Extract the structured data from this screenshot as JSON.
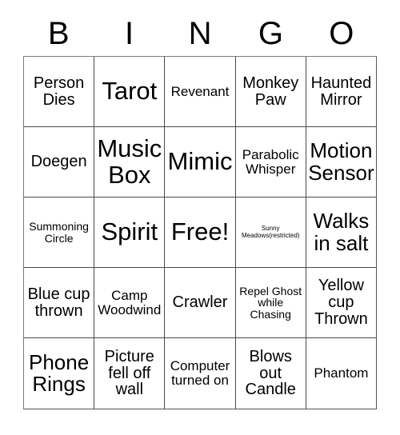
{
  "card": {
    "header": {
      "letters": [
        "B",
        "I",
        "N",
        "G",
        "O"
      ]
    },
    "rows": [
      [
        {
          "text": "Person Dies",
          "size": "fs-md"
        },
        {
          "text": "Tarot",
          "size": "fs-xl"
        },
        {
          "text": "Revenant",
          "size": "fs-sm"
        },
        {
          "text": "Monkey Paw",
          "size": "fs-md"
        },
        {
          "text": "Haunted Mirror",
          "size": "fs-md"
        }
      ],
      [
        {
          "text": "Doegen",
          "size": "fs-md"
        },
        {
          "text": "Music Box",
          "size": "fs-xl"
        },
        {
          "text": "Mimic",
          "size": "fs-xl"
        },
        {
          "text": "Parabolic Whisper",
          "size": "fs-sm"
        },
        {
          "text": "Motion Sensor",
          "size": "fs-lg"
        }
      ],
      [
        {
          "text": "Summoning Circle",
          "size": "fs-xs"
        },
        {
          "text": "Spirit",
          "size": "fs-xl"
        },
        {
          "text": "Free!",
          "size": "fs-xl"
        },
        {
          "text": "Sunny Meadows(restricted)",
          "size": "fs-xxs"
        },
        {
          "text": "Walks in salt",
          "size": "fs-lg"
        }
      ],
      [
        {
          "text": "Blue cup thrown",
          "size": "fs-md"
        },
        {
          "text": "Camp Woodwind",
          "size": "fs-sm"
        },
        {
          "text": "Crawler",
          "size": "fs-md"
        },
        {
          "text": "Repel Ghost while Chasing",
          "size": "fs-xs"
        },
        {
          "text": "Yellow cup Thrown",
          "size": "fs-md"
        }
      ],
      [
        {
          "text": "Phone Rings",
          "size": "fs-lg"
        },
        {
          "text": "Picture fell off wall",
          "size": "fs-md"
        },
        {
          "text": "Computer turned on",
          "size": "fs-sm"
        },
        {
          "text": "Blows out Candle",
          "size": "fs-md"
        },
        {
          "text": "Phantom",
          "size": "fs-sm"
        }
      ]
    ]
  },
  "colors": {
    "background": "#ffffff",
    "text": "#000000",
    "grid_line": "#4a4a4a"
  }
}
